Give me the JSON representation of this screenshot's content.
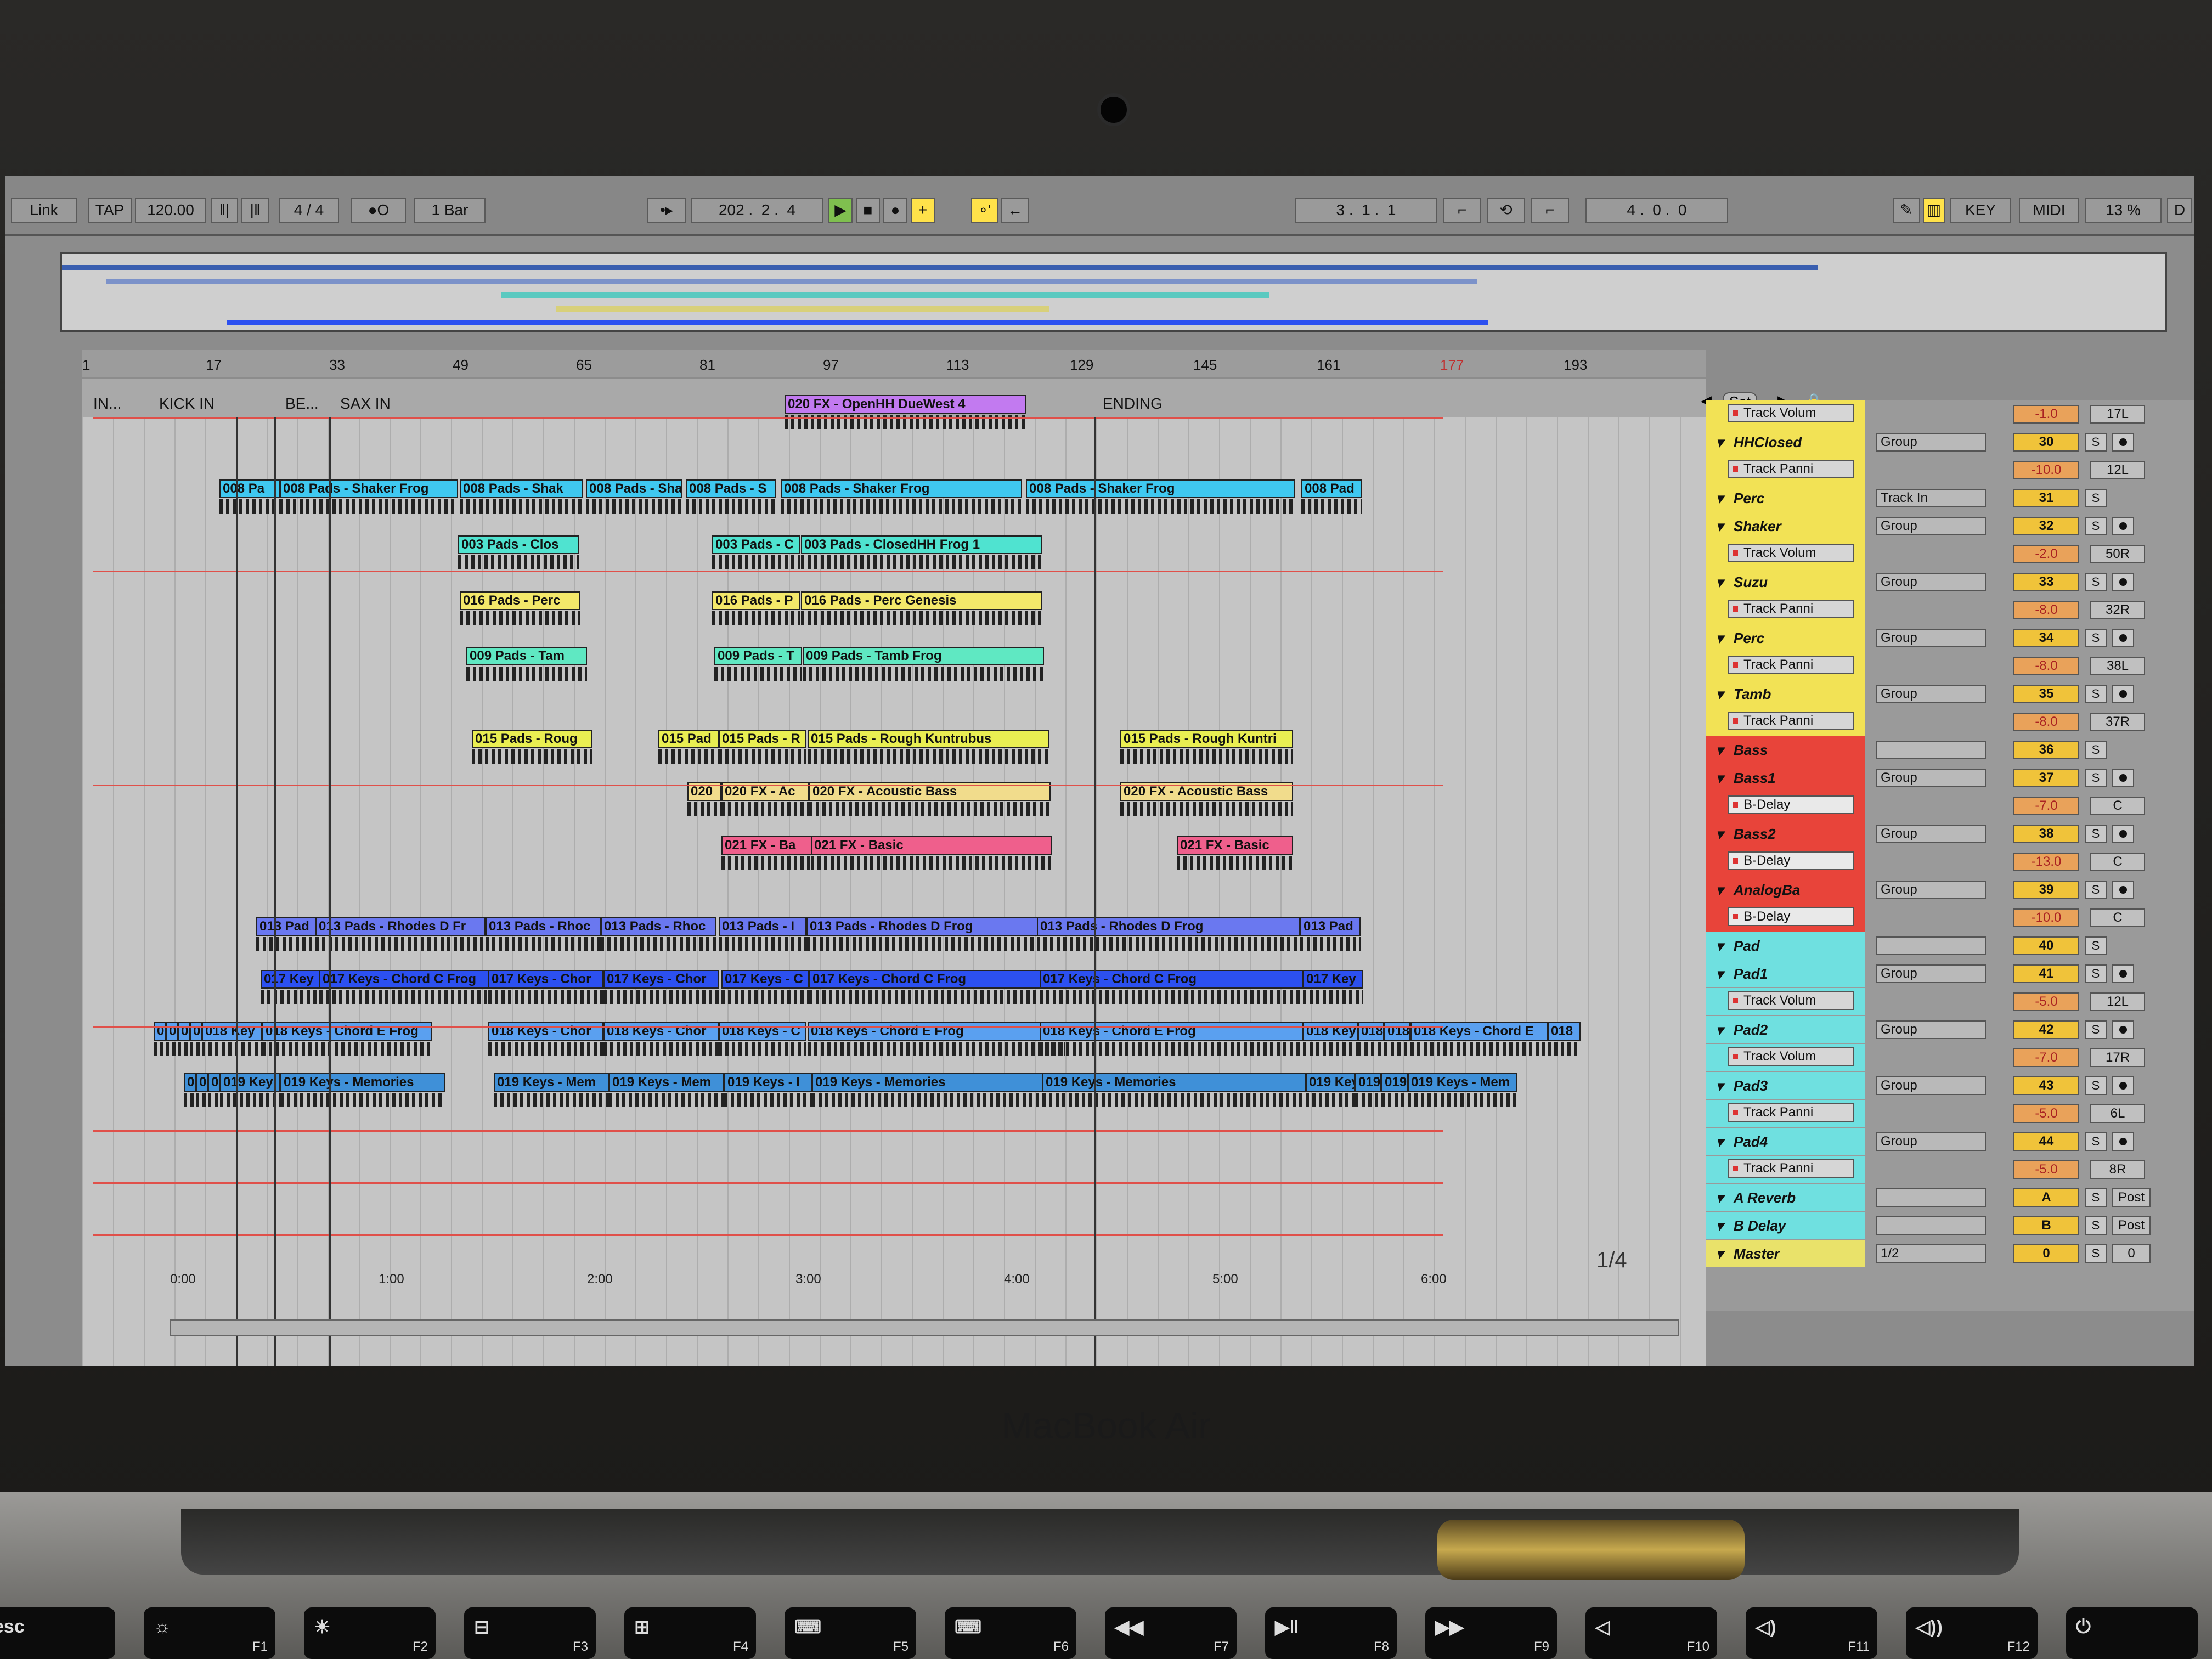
{
  "control_bar": {
    "link": "Link",
    "tap": "TAP",
    "tempo": "120.00",
    "meter_num": "4",
    "meter_sep": "/",
    "meter_den": "4",
    "metronome": "●O",
    "quantize": "1 Bar",
    "position_bar": "202",
    "position_beat": "2",
    "position_sixteenth": "4",
    "loop_start_bar": "3",
    "loop_start_beat": "1",
    "loop_start_sixteenth": "1",
    "loop_length_bar": "4",
    "loop_length_beat": "0",
    "loop_length_sixteenth": "0",
    "key": "KEY",
    "midi": "MIDI",
    "cpu": "13 %",
    "d": "D"
  },
  "ruler": [
    "1",
    "17",
    "33",
    "49",
    "65",
    "81",
    "97",
    "113",
    "129",
    "145",
    "161",
    "177",
    "193"
  ],
  "locators": [
    {
      "label": "IN..."
    },
    {
      "label": "KICK IN"
    },
    {
      "label": "BE..."
    },
    {
      "label": "SAX IN"
    },
    {
      "label": "ENDING"
    }
  ],
  "set_label": "Set",
  "page_indicator": "1/4",
  "timebar": [
    "0:00",
    "1:00",
    "2:00",
    "3:00",
    "4:00",
    "5:00",
    "6:00"
  ],
  "clips": [
    {
      "text": "020 FX - OpenHH DueWest 4",
      "color": "#c27af0"
    },
    {
      "text": "008 Pa",
      "color": "#3fc8f0"
    },
    {
      "text": "008 Pads - Shaker Frog",
      "color": "#3fc8f0"
    },
    {
      "text": "008 Pads - Shak",
      "color": "#3fc8f0"
    },
    {
      "text": "008 Pads - Shak",
      "color": "#3fc8f0"
    },
    {
      "text": "008 Pads - S",
      "color": "#3fc8f0"
    },
    {
      "text": "008 Pads - Shaker Frog",
      "color": "#3fc8f0"
    },
    {
      "text": "008 Pads - Shaker Frog",
      "color": "#3fc8f0"
    },
    {
      "text": "008 Pad",
      "color": "#3fc8f0"
    },
    {
      "text": "003 Pads - Clos",
      "color": "#4fe3d0"
    },
    {
      "text": "003 Pads - C",
      "color": "#4fe3d0"
    },
    {
      "text": "003 Pads - ClosedHH Frog 1",
      "color": "#4fe3d0"
    },
    {
      "text": "016 Pads - Perc",
      "color": "#f3e86a"
    },
    {
      "text": "016 Pads - P",
      "color": "#f3e86a"
    },
    {
      "text": "016 Pads - Perc Genesis",
      "color": "#f3e86a"
    },
    {
      "text": "009 Pads - Tam",
      "color": "#5fe8c2"
    },
    {
      "text": "009 Pads - T",
      "color": "#5fe8c2"
    },
    {
      "text": "009 Pads - Tamb Frog",
      "color": "#5fe8c2"
    },
    {
      "text": "015 Pads - Roug",
      "color": "#e9ee52"
    },
    {
      "text": "015 Pad",
      "color": "#e9ee52"
    },
    {
      "text": "015 Pads - R",
      "color": "#e9ee52"
    },
    {
      "text": "015 Pads - Rough Kuntrubus",
      "color": "#e9ee52"
    },
    {
      "text": "015 Pads - Rough Kuntri",
      "color": "#e9ee52"
    },
    {
      "text": "020",
      "color": "#f1dc8c"
    },
    {
      "text": "020 FX - Ac",
      "color": "#f1dc8c"
    },
    {
      "text": "020 FX - Acoustic Bass",
      "color": "#f1dc8c"
    },
    {
      "text": "020 FX - Acoustic Bass",
      "color": "#f1dc8c"
    },
    {
      "text": "021 FX - Ba",
      "color": "#ef5f8c"
    },
    {
      "text": "021 FX - Basic",
      "color": "#ef5f8c"
    },
    {
      "text": "021 FX - Basic",
      "color": "#ef5f8c"
    },
    {
      "text": "013 Pad",
      "color": "#6a78f0"
    },
    {
      "text": "013 Pads - Rhodes D Fr",
      "color": "#6a78f0"
    },
    {
      "text": "013 Pads - Rhoc",
      "color": "#6a78f0"
    },
    {
      "text": "013 Pads - Rhoc",
      "color": "#6a78f0"
    },
    {
      "text": "013 Pads - I",
      "color": "#6a78f0"
    },
    {
      "text": "013 Pads - Rhodes D Frog",
      "color": "#6a78f0"
    },
    {
      "text": "013 Pads - Rhodes D Frog",
      "color": "#6a78f0"
    },
    {
      "text": "013 Pad",
      "color": "#6a78f0"
    },
    {
      "text": "017 Key",
      "color": "#2c50f0"
    },
    {
      "text": "017 Keys - Chord C Frog",
      "color": "#2c50f0"
    },
    {
      "text": "017 Keys - Chor",
      "color": "#2c50f0"
    },
    {
      "text": "017 Keys - Chor",
      "color": "#2c50f0"
    },
    {
      "text": "017 Keys - C",
      "color": "#2c50f0"
    },
    {
      "text": "017 Keys - Chord C Frog",
      "color": "#2c50f0"
    },
    {
      "text": "017 Keys - Chord C Frog",
      "color": "#2c50f0"
    },
    {
      "text": "017 Key",
      "color": "#2c50f0"
    },
    {
      "text": "018",
      "color": "#5aa0f0"
    },
    {
      "text": "018",
      "color": "#5aa0f0"
    },
    {
      "text": "018",
      "color": "#5aa0f0"
    },
    {
      "text": "018",
      "color": "#5aa0f0"
    },
    {
      "text": "018 Key",
      "color": "#5aa0f0"
    },
    {
      "text": "018 Keys - Chord E Frog",
      "color": "#5aa0f0"
    },
    {
      "text": "018 Keys - Chor",
      "color": "#5aa0f0"
    },
    {
      "text": "018 Keys - Chor",
      "color": "#5aa0f0"
    },
    {
      "text": "018 Keys - C",
      "color": "#5aa0f0"
    },
    {
      "text": "018 Keys - Chord E Frog",
      "color": "#5aa0f0"
    },
    {
      "text": "018 Keys - Chord E Frog",
      "color": "#5aa0f0"
    },
    {
      "text": "018 Key",
      "color": "#5aa0f0"
    },
    {
      "text": "018",
      "color": "#5aa0f0"
    },
    {
      "text": "018",
      "color": "#5aa0f0"
    },
    {
      "text": "018 Keys - Chord E",
      "color": "#5aa0f0"
    },
    {
      "text": "018",
      "color": "#5aa0f0"
    },
    {
      "text": "019",
      "color": "#3f90d8"
    },
    {
      "text": "019",
      "color": "#3f90d8"
    },
    {
      "text": "019",
      "color": "#3f90d8"
    },
    {
      "text": "019 Key",
      "color": "#3f90d8"
    },
    {
      "text": "019 Keys - Memories",
      "color": "#3f90d8"
    },
    {
      "text": "019 Keys - Mem",
      "color": "#3f90d8"
    },
    {
      "text": "019 Keys - Mem",
      "color": "#3f90d8"
    },
    {
      "text": "019 Keys - I",
      "color": "#3f90d8"
    },
    {
      "text": "019 Keys - Memories",
      "color": "#3f90d8"
    },
    {
      "text": "019 Keys - Memories",
      "color": "#3f90d8"
    },
    {
      "text": "019 Key",
      "color": "#3f90d8"
    },
    {
      "text": "019",
      "color": "#3f90d8"
    },
    {
      "text": "019",
      "color": "#3f90d8"
    },
    {
      "text": "019 Keys - Mem",
      "color": "#3f90d8"
    }
  ],
  "mixer": [
    {
      "type": "auto",
      "param": "Track Volum",
      "vol": "-1.0",
      "pan": "17L",
      "color": "#f2e255"
    },
    {
      "type": "track",
      "name": "HHClosed",
      "dd": "Group",
      "num": "30",
      "color": "#f2e255"
    },
    {
      "type": "auto",
      "param": "Track Panni",
      "vol": "-10.0",
      "pan": "12L",
      "color": "#f2e255"
    },
    {
      "type": "group",
      "name": "Perc",
      "dd": "Track In",
      "num": "31",
      "color": "#f2e255"
    },
    {
      "type": "track",
      "name": "Shaker",
      "dd": "Group",
      "num": "32",
      "color": "#f2e255"
    },
    {
      "type": "auto",
      "param": "Track Volum",
      "vol": "-2.0",
      "pan": "50R",
      "color": "#f2e255"
    },
    {
      "type": "track",
      "name": "Suzu",
      "dd": "Group",
      "num": "33",
      "color": "#f2e255"
    },
    {
      "type": "auto",
      "param": "Track Panni",
      "vol": "-8.0",
      "pan": "32R",
      "color": "#f2e255"
    },
    {
      "type": "track",
      "name": "Perc",
      "dd": "Group",
      "num": "34",
      "color": "#f2e255"
    },
    {
      "type": "auto",
      "param": "Track Panni",
      "vol": "-8.0",
      "pan": "38L",
      "color": "#f2e255"
    },
    {
      "type": "track",
      "name": "Tamb",
      "dd": "Group",
      "num": "35",
      "color": "#f2e255"
    },
    {
      "type": "auto",
      "param": "Track Panni",
      "vol": "-8.0",
      "pan": "37R",
      "color": "#f2e255"
    },
    {
      "type": "group",
      "name": "Bass",
      "dd": "",
      "num": "36",
      "color": "#e8443a"
    },
    {
      "type": "track",
      "name": "Bass1",
      "dd": "Group",
      "num": "37",
      "color": "#e8443a"
    },
    {
      "type": "auto",
      "param": "B-Delay",
      "vol": "-7.0",
      "pan": "C",
      "color": "#e8443a"
    },
    {
      "type": "track",
      "name": "Bass2",
      "dd": "Group",
      "num": "38",
      "color": "#e8443a"
    },
    {
      "type": "auto",
      "param": "B-Delay",
      "vol": "-13.0",
      "pan": "C",
      "color": "#e8443a"
    },
    {
      "type": "track",
      "name": "AnalogBa",
      "dd": "Group",
      "num": "39",
      "color": "#e8443a"
    },
    {
      "type": "auto",
      "param": "B-Delay",
      "vol": "-10.0",
      "pan": "C",
      "color": "#e8443a"
    },
    {
      "type": "group",
      "name": "Pad",
      "dd": "",
      "num": "40",
      "color": "#6fe0e0"
    },
    {
      "type": "track",
      "name": "Pad1",
      "dd": "Group",
      "num": "41",
      "color": "#6fe0e0"
    },
    {
      "type": "auto",
      "param": "Track Volum",
      "vol": "-5.0",
      "pan": "12L",
      "color": "#6fe0e0"
    },
    {
      "type": "track",
      "name": "Pad2",
      "dd": "Group",
      "num": "42",
      "color": "#6fe0e0"
    },
    {
      "type": "auto",
      "param": "Track Volum",
      "vol": "-7.0",
      "pan": "17R",
      "color": "#6fe0e0"
    },
    {
      "type": "track",
      "name": "Pad3",
      "dd": "Group",
      "num": "43",
      "color": "#6fe0e0"
    },
    {
      "type": "auto",
      "param": "Track Panni",
      "vol": "-5.0",
      "pan": "6L",
      "color": "#6fe0e0"
    },
    {
      "type": "track",
      "name": "Pad4",
      "dd": "Group",
      "num": "44",
      "color": "#6fe0e0"
    },
    {
      "type": "auto",
      "param": "Track Panni",
      "vol": "-5.0",
      "pan": "8R",
      "color": "#6fe0e0"
    },
    {
      "type": "return",
      "name": "A Reverb",
      "dd": "",
      "num": "A",
      "extra": "Post",
      "color": "#6fe0e0"
    },
    {
      "type": "return",
      "name": "B Delay",
      "dd": "",
      "num": "B",
      "extra": "Post",
      "color": "#6fe0e0"
    },
    {
      "type": "master",
      "name": "Master",
      "dd": "1/2",
      "num": "0",
      "extra": "0",
      "color": "#e9e26a"
    }
  ],
  "brand": "MacBook Air",
  "keyboard": [
    {
      "label": "esc",
      "fn": ""
    },
    {
      "label": "☼",
      "fn": "F1"
    },
    {
      "label": "☀",
      "fn": "F2"
    },
    {
      "label": "⊟",
      "fn": "F3"
    },
    {
      "label": "⊞",
      "fn": "F4"
    },
    {
      "label": "⌨",
      "fn": "F5"
    },
    {
      "label": "⌨",
      "fn": "F6"
    },
    {
      "label": "◀◀",
      "fn": "F7"
    },
    {
      "label": "▶‖",
      "fn": "F8"
    },
    {
      "label": "▶▶",
      "fn": "F9"
    },
    {
      "label": "◁",
      "fn": "F10"
    },
    {
      "label": "◁)",
      "fn": "F11"
    },
    {
      "label": "◁))",
      "fn": "F12"
    },
    {
      "label": "⏻",
      "fn": ""
    }
  ]
}
